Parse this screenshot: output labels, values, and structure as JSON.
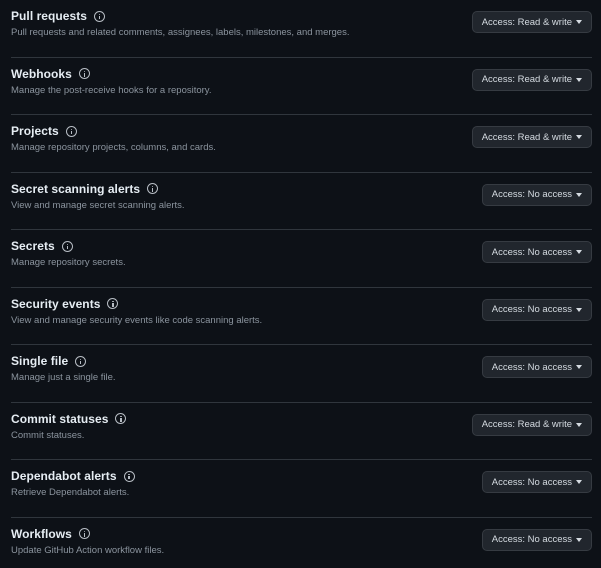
{
  "permissions": [
    {
      "title": "Pull requests",
      "description": "Pull requests and related comments, assignees, labels, milestones, and merges.",
      "access": "Access: Read & write"
    },
    {
      "title": "Webhooks",
      "description": "Manage the post-receive hooks for a repository.",
      "access": "Access: Read & write"
    },
    {
      "title": "Projects",
      "description": "Manage repository projects, columns, and cards.",
      "access": "Access: Read & write"
    },
    {
      "title": "Secret scanning alerts",
      "description": "View and manage secret scanning alerts.",
      "access": "Access: No access"
    },
    {
      "title": "Secrets",
      "description": "Manage repository secrets.",
      "access": "Access: No access"
    },
    {
      "title": "Security events",
      "description": "View and manage security events like code scanning alerts.",
      "access": "Access: No access"
    },
    {
      "title": "Single file",
      "description": "Manage just a single file.",
      "access": "Access: No access"
    },
    {
      "title": "Commit statuses",
      "description": "Commit statuses.",
      "access": "Access: Read & write"
    },
    {
      "title": "Dependabot alerts",
      "description": "Retrieve Dependabot alerts.",
      "access": "Access: No access"
    },
    {
      "title": "Workflows",
      "description": "Update GitHub Action workflow files.",
      "access": "Access: No access"
    }
  ],
  "colors": {
    "background": "#0d1117",
    "separator": "#30363d",
    "button_bg": "#21262d",
    "title_text": "#e6edf3",
    "description_text": "#8b949e"
  },
  "icons": {
    "info": "info-icon",
    "dropdown": "caret-down-icon"
  }
}
